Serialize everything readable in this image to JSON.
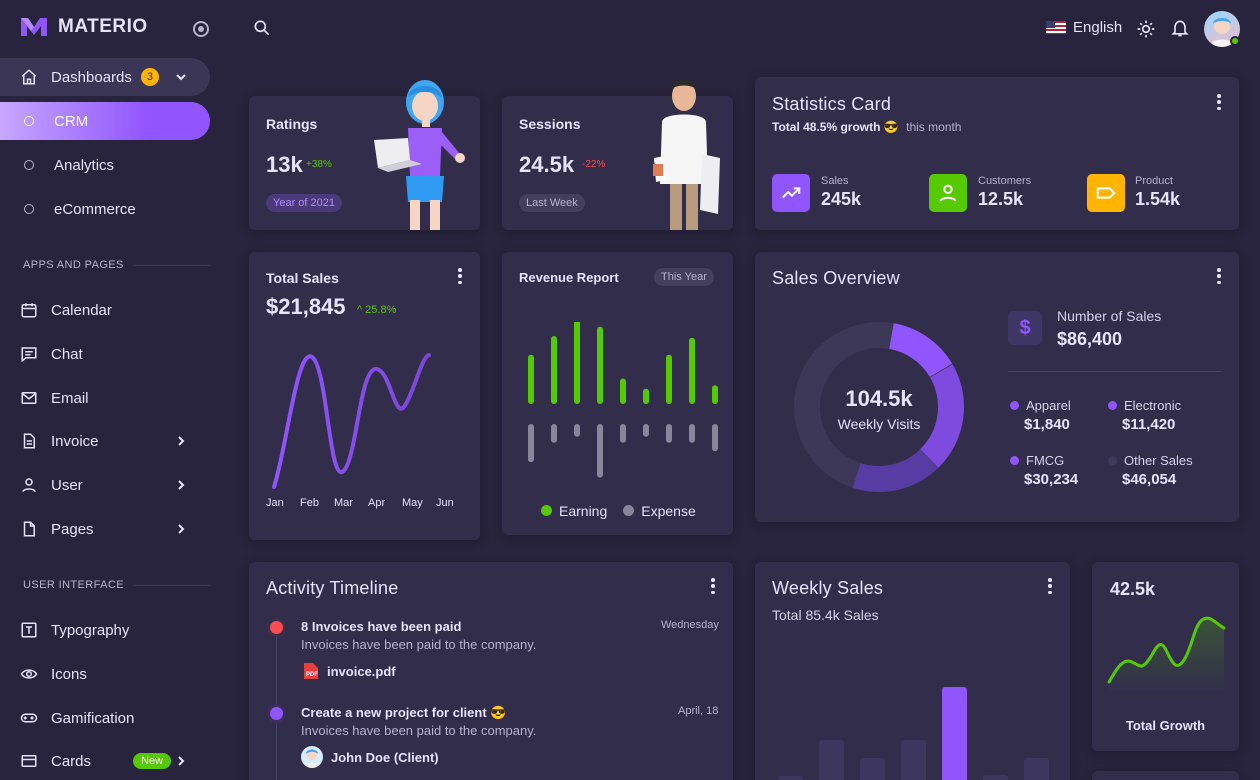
{
  "brand": {
    "name": "MATERIO"
  },
  "sidebar": {
    "dashboards": {
      "label": "Dashboards",
      "badge": "3"
    },
    "dashboard_items": [
      {
        "label": "CRM",
        "active": true
      },
      {
        "label": "Analytics"
      },
      {
        "label": "eCommerce"
      }
    ],
    "section_apps": "APPS AND PAGES",
    "apps": [
      {
        "label": "Calendar"
      },
      {
        "label": "Chat"
      },
      {
        "label": "Email"
      },
      {
        "label": "Invoice"
      },
      {
        "label": "User"
      },
      {
        "label": "Pages"
      }
    ],
    "section_ui": "USER INTERFACE",
    "ui": [
      {
        "label": "Typography"
      },
      {
        "label": "Icons"
      },
      {
        "label": "Gamification"
      },
      {
        "label": "Cards",
        "badge": "New"
      }
    ]
  },
  "topbar": {
    "language": "English"
  },
  "ratings": {
    "title": "Ratings",
    "value": "13k",
    "change": "+38%",
    "chip": "Year of 2021"
  },
  "sessions": {
    "title": "Sessions",
    "value": "24.5k",
    "change": "-22%",
    "chip": "Last Week"
  },
  "statistics": {
    "title": "Statistics Card",
    "subtitle_bold": "Total 48.5% growth",
    "subtitle_emoji": "😎",
    "subtitle_rest": "this month",
    "items": [
      {
        "label": "Sales",
        "value": "245k",
        "color": "#9155fd",
        "icon": "trending-up-icon"
      },
      {
        "label": "Customers",
        "value": "12.5k",
        "color": "#56ca00",
        "icon": "user-icon"
      },
      {
        "label": "Product",
        "value": "1.54k",
        "color": "#ffb400",
        "icon": "label-icon"
      }
    ]
  },
  "total_sales": {
    "title": "Total Sales",
    "value": "$21,845",
    "change": "25.8%",
    "months": [
      "Jan",
      "Feb",
      "Mar",
      "Apr",
      "May",
      "Jun"
    ]
  },
  "revenue": {
    "title": "Revenue Report",
    "chip": "This Year",
    "legend": [
      "Earning",
      "Expense"
    ],
    "earning": [
      58,
      80,
      100,
      91,
      30,
      18,
      58,
      78,
      22
    ],
    "expense": [
      45,
      22,
      15,
      63,
      22,
      15,
      22,
      22,
      32
    ],
    "earning_color": "#56ca00",
    "expense_color": "#8a8699"
  },
  "sales_overview": {
    "title": "Sales Overview",
    "center_value": "104.5k",
    "center_label": "Weekly Visits",
    "number_label": "Number of Sales",
    "number_value": "$86,400",
    "items": [
      {
        "label": "Apparel",
        "value": "$1,840",
        "color": "#9155fd"
      },
      {
        "label": "Electronic",
        "value": "$11,420",
        "color": "#9155fd"
      },
      {
        "label": "FMCG",
        "value": "$30,234",
        "color": "#9155fd"
      },
      {
        "label": "Other Sales",
        "value": "$46,054",
        "color": "#3f3a5b"
      }
    ]
  },
  "activity": {
    "title": "Activity Timeline",
    "entries": [
      {
        "title": "8 Invoices have been paid",
        "time": "Wednesday",
        "desc": "Invoices have been paid to the company.",
        "attachment": "invoice.pdf",
        "dot": "#ff4c51"
      },
      {
        "title": "Create a new project for client 😎",
        "time": "April, 18",
        "desc": "Invoices have been paid to the company.",
        "person": "John Doe (Client)",
        "dot": "#9155fd"
      }
    ]
  },
  "weekly_sales": {
    "title": "Weekly Sales",
    "subtitle": "Total 85.4k Sales",
    "bars": [
      22,
      58,
      40,
      58,
      111,
      23,
      40
    ]
  },
  "total_growth": {
    "value": "42.5k",
    "label": "Total Growth"
  }
}
